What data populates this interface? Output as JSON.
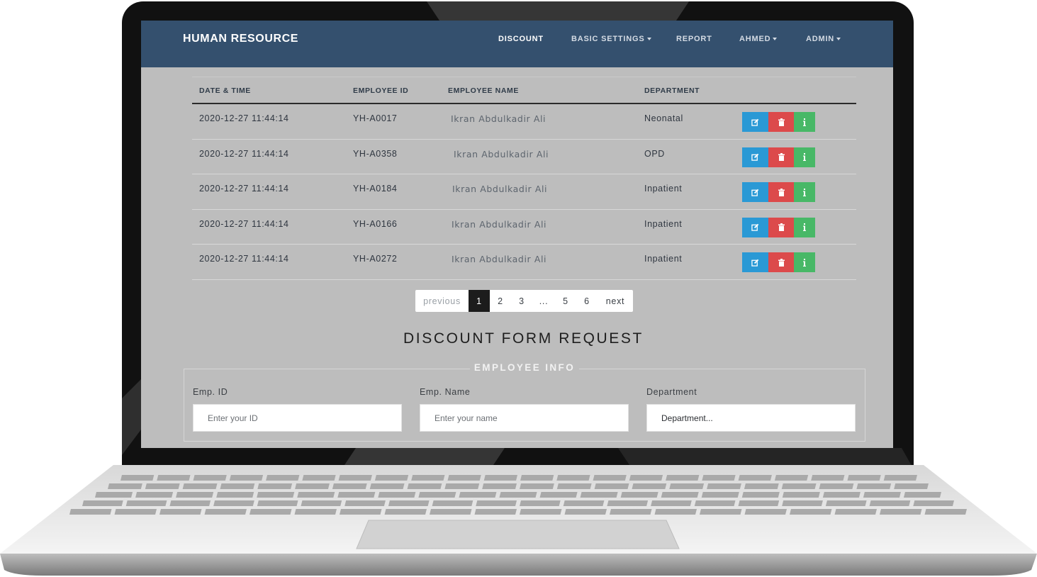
{
  "navbar": {
    "brand": "HUMAN RESOURCE",
    "items": [
      {
        "label": "DISCOUNT",
        "active": true,
        "dropdown": false
      },
      {
        "label": "BASIC SETTINGS",
        "active": false,
        "dropdown": true
      },
      {
        "label": "REPORT",
        "active": false,
        "dropdown": false
      },
      {
        "label": "AHMED",
        "active": false,
        "dropdown": true
      },
      {
        "label": "ADMIN",
        "active": false,
        "dropdown": true
      }
    ]
  },
  "table": {
    "headers": [
      "DATE & TIME",
      "EMPLOYEE ID",
      "EMPLOYEE NAME",
      "DEPARTMENT"
    ],
    "rows": [
      {
        "datetime": "2020-12-27 11:44:14",
        "employee_id": "YH-A0017",
        "name": "Ikran Abdulkadir Ali",
        "department": "Neonatal"
      },
      {
        "datetime": "2020-12-27 11:44:14",
        "employee_id": "YH-A0358",
        "name": "Ikran Abdulkadir Ali",
        "department": "OPD"
      },
      {
        "datetime": "2020-12-27 11:44:14",
        "employee_id": "YH-A0184",
        "name": "Ikran Abdulkadir Ali",
        "department": "Inpatient"
      },
      {
        "datetime": "2020-12-27 11:44:14",
        "employee_id": "YH-A0166",
        "name": "Ikran Abdulkadir Ali",
        "department": "Inpatient"
      },
      {
        "datetime": "2020-12-27 11:44:14",
        "employee_id": "YH-A0272",
        "name": "Ikran Abdulkadir Ali",
        "department": "Inpatient"
      }
    ],
    "actions": {
      "edit_icon": "edit-icon",
      "delete_icon": "trash-icon",
      "info_icon": "info-icon"
    }
  },
  "pagination": {
    "previous": "previous",
    "pages": [
      "1",
      "2",
      "3",
      "...",
      "5",
      "6"
    ],
    "current": "1",
    "next": "next"
  },
  "form": {
    "title": "DISCOUNT FORM REQUEST",
    "legend": "EMPLOYEE INFO",
    "fields": [
      {
        "label": "Emp. ID",
        "placeholder": "Enter your ID"
      },
      {
        "label": "Emp. Name",
        "placeholder": "Enter your name"
      },
      {
        "label": "Department",
        "placeholder": "Department..."
      }
    ]
  },
  "colors": {
    "navbar": "#34506e",
    "edit": "#2a99d5",
    "delete": "#dc4a4b",
    "info": "#48b867",
    "screen_bg": "#bdbdbd"
  }
}
